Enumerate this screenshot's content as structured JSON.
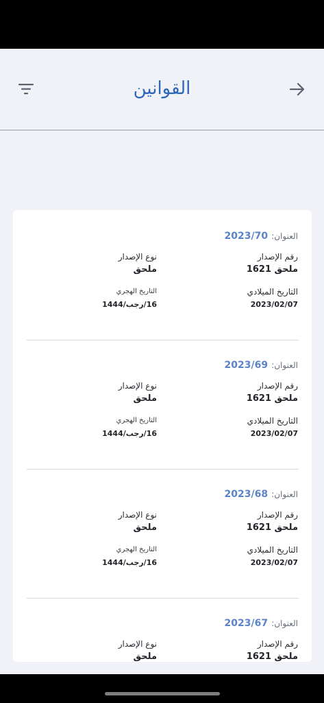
{
  "header": {
    "title": "القوانين"
  },
  "icons": {
    "filter": "filter-icon",
    "back": "arrow-right-icon"
  },
  "colors": {
    "accent": "#2f67b8",
    "title_value": "#5b83c7",
    "background": "#f0f2f7"
  },
  "labels": {
    "title": "العنوان:",
    "issue_number": "رقم الإصدار",
    "issue_type": "نوع الإصدار",
    "gregorian_date": "التاريخ الميلادي",
    "hijri_date": "التاريخ الهجري"
  },
  "items": [
    {
      "title": "2023/70",
      "issue_number": "ملحق 1621",
      "issue_type": "ملحق",
      "gregorian_date": "2023/02/07",
      "hijri_date": "16/رجب/1444"
    },
    {
      "title": "2023/69",
      "issue_number": "ملحق 1621",
      "issue_type": "ملحق",
      "gregorian_date": "2023/02/07",
      "hijri_date": "16/رجب/1444"
    },
    {
      "title": "2023/68",
      "issue_number": "ملحق 1621",
      "issue_type": "ملحق",
      "gregorian_date": "2023/02/07",
      "hijri_date": "16/رجب/1444"
    },
    {
      "title": "2023/67",
      "issue_number": "ملحق 1621",
      "issue_type": "ملحق"
    }
  ]
}
